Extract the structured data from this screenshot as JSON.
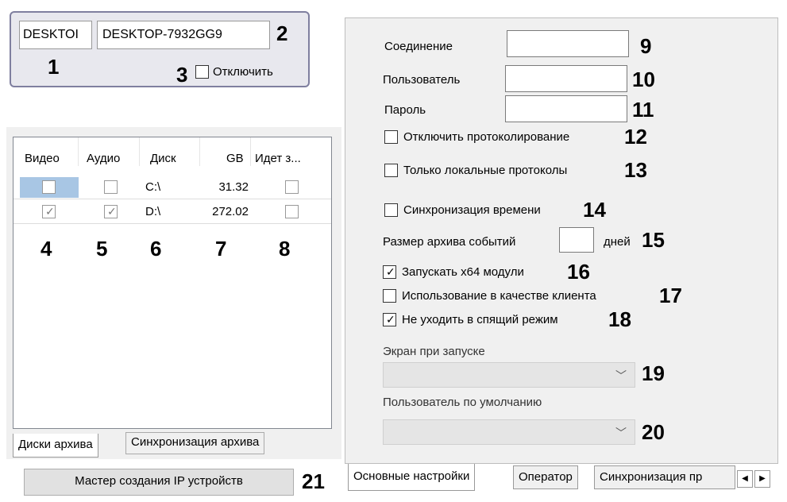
{
  "computer": {
    "short_name": "DESKTOI",
    "full_name": "DESKTOP-7932GG9",
    "disable_label": "Отключить"
  },
  "disks_table": {
    "columns": [
      "Видео",
      "Аудио",
      "Диск",
      "GB",
      "Идет з..."
    ],
    "rows": [
      {
        "video": false,
        "audio": false,
        "disk": "C:\\",
        "gb": "31.32",
        "recording": false
      },
      {
        "video": true,
        "audio": true,
        "disk": "D:\\",
        "gb": "272.02",
        "recording": false
      }
    ]
  },
  "left_tabs": [
    "Диски архива",
    "Синхронизация архива"
  ],
  "wizard_button": "Мастер создания IP устройств",
  "settings": {
    "connection_label": "Соединение",
    "user_label": "Пользователь",
    "password_label": "Пароль",
    "disable_logging_label": "Отключить протоколирование",
    "local_logs_label": "Только локальные протоколы",
    "time_sync_label": "Синхронизация времени",
    "event_archive_prefix": "Размер архива событий",
    "event_archive_suffix": "дней",
    "run_x64_label": "Запускать x64 модули",
    "client_use_label": "Использование в качестве клиента",
    "no_sleep_label": "Не уходить в спящий режим",
    "startup_screen_label": "Экран при запуске",
    "default_user_label": "Пользователь по умолчанию"
  },
  "right_tabs": [
    "Основные настройки",
    "Оператор",
    "Синхронизация пр"
  ],
  "markers": [
    "1",
    "2",
    "3",
    "4",
    "5",
    "6",
    "7",
    "8",
    "9",
    "10",
    "11",
    "12",
    "13",
    "14",
    "15",
    "16",
    "17",
    "18",
    "19",
    "20",
    "21"
  ],
  "checkbox_states": {
    "disable": false,
    "disable_logging": false,
    "local_logs": false,
    "time_sync": false,
    "run_x64": true,
    "client_use": false,
    "no_sleep": true
  }
}
